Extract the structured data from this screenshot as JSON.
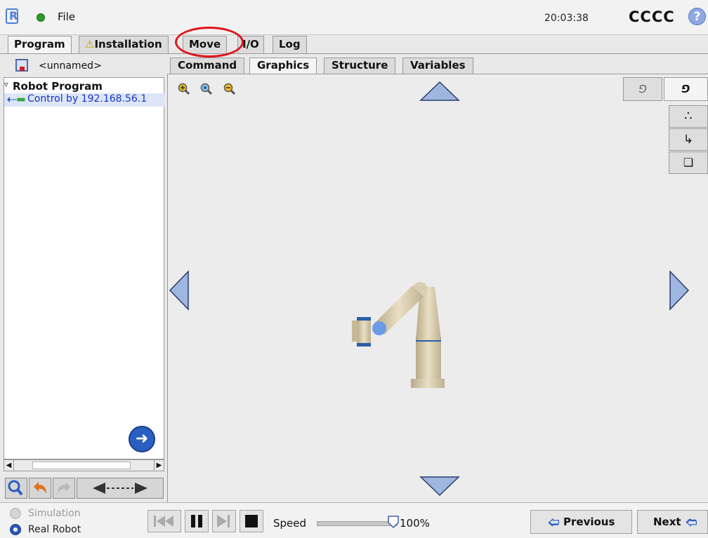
{
  "topbar": {
    "file_label": "File",
    "clock": "20:03:38",
    "robot_name": "CCCC",
    "help_label": "?"
  },
  "tabs": [
    {
      "label": "Program",
      "active": true
    },
    {
      "label": "Installation",
      "warning": true
    },
    {
      "label": "Move"
    },
    {
      "label": "I/O"
    },
    {
      "label": "Log"
    }
  ],
  "program": {
    "filename": "<unnamed>",
    "tree_root": "Robot Program",
    "tree_child": "Control by 192.168.56.1"
  },
  "subtabs": [
    {
      "label": "Command"
    },
    {
      "label": "Graphics",
      "active": true
    },
    {
      "label": "Structure"
    },
    {
      "label": "Variables"
    }
  ],
  "bottom": {
    "simulation_label": "Simulation",
    "real_robot_label": "Real Robot",
    "speed_label": "Speed",
    "speed_value": "100%",
    "speed_fraction": 1.0,
    "previous_label": "Previous",
    "next_label": "Next"
  },
  "colors": {
    "accent_blue": "#2a5fc1",
    "highlight_red": "#e0141b",
    "selection": "#dde6f8"
  }
}
